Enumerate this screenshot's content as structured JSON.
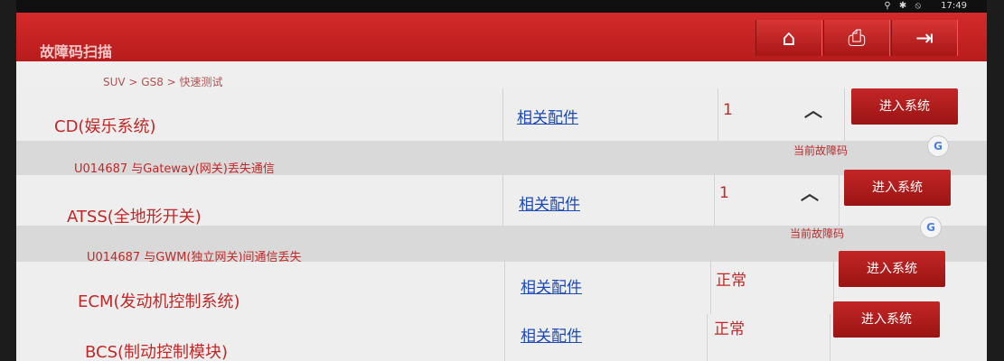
{
  "status_bar": {
    "icons": "⚲ ✱ ⦸",
    "time": "17:49"
  },
  "header": {
    "title": "故障码扫描",
    "home_icon": "home-icon",
    "print_icon": "printer-icon",
    "exit_icon": "exit-icon"
  },
  "breadcrumb": "SUV > GS8 > 快速测试",
  "systems": [
    {
      "name": "CD(娱乐系统)",
      "link": "相关配件",
      "value": "1",
      "button": "进入系统",
      "expanded": true,
      "fault": "U014687 与Gateway(网关)丢失通信",
      "fault_label": "当前故障码"
    },
    {
      "name": "ATSS(全地形开关)",
      "link": "相关配件",
      "value": "1",
      "button": "进入系统",
      "expanded": true,
      "fault": "U014687 与GWM(独立网关)间通信丢失",
      "fault_label": "当前故障码"
    },
    {
      "name": "ECM(发动机控制系统)",
      "link": "相关配件",
      "value": "正常",
      "button": "进入系统"
    },
    {
      "name": "BCS(制动控制模块)",
      "link": "相关配件",
      "value": "正常",
      "button": "进入系统"
    }
  ]
}
